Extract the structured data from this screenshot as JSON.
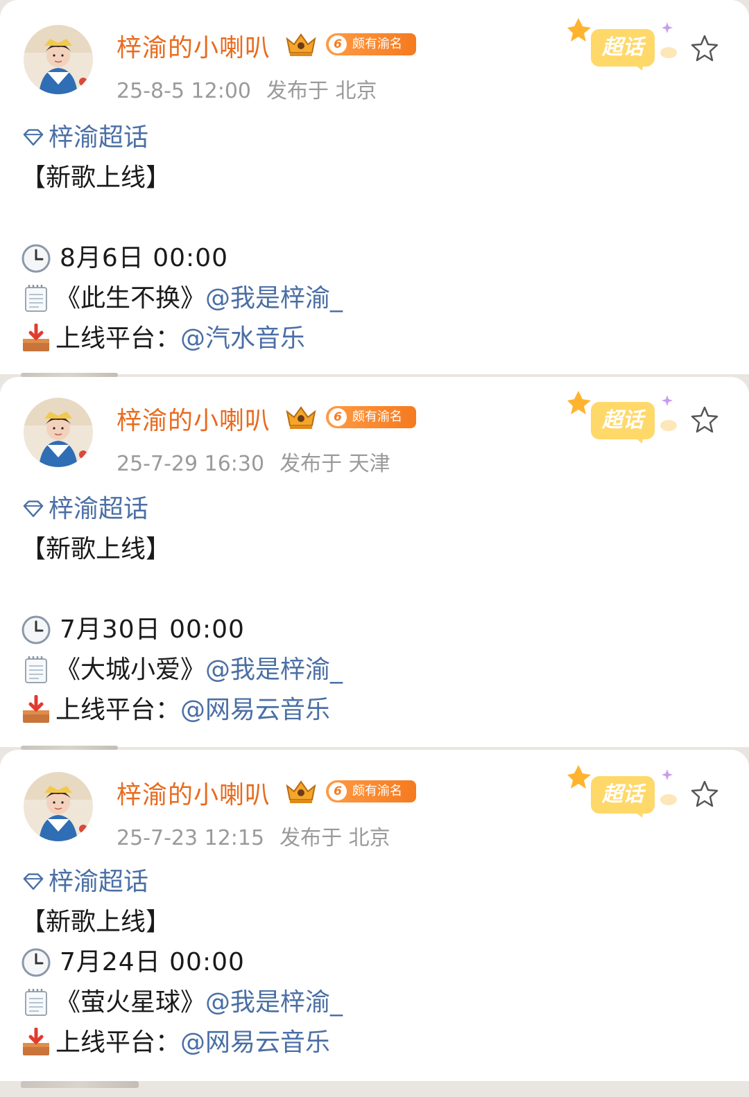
{
  "posts": [
    {
      "username": "梓渝的小喇叭",
      "fan_badge": {
        "level": "6",
        "text": "颇有渝名"
      },
      "time": "25-8-5 12:00",
      "location": "发布于 北京",
      "chaohua_label": "超话",
      "topic": "梓渝超话",
      "headline": "【新歌上线】",
      "date_line": "8月6日 00:00",
      "song_title": "《此生不换》",
      "song_mention": "@我是梓渝_",
      "platform_label": "上线平台：",
      "platform_mention": "@汽水音乐"
    },
    {
      "username": "梓渝的小喇叭",
      "fan_badge": {
        "level": "6",
        "text": "颇有渝名"
      },
      "time": "25-7-29 16:30",
      "location": "发布于 天津",
      "chaohua_label": "超话",
      "topic": "梓渝超话",
      "headline": "【新歌上线】",
      "date_line": "7月30日 00:00",
      "song_title": "《大城小爱》",
      "song_mention": "@我是梓渝_",
      "platform_label": "上线平台：",
      "platform_mention": "@网易云音乐"
    },
    {
      "username": "梓渝的小喇叭",
      "fan_badge": {
        "level": "6",
        "text": "颇有渝名"
      },
      "time": "25-7-23 12:15",
      "location": "发布于 北京",
      "chaohua_label": "超话",
      "topic": "梓渝超话",
      "headline": "【新歌上线】",
      "date_line": "7月24日 00:00",
      "song_title": "《萤火星球》",
      "song_mention": "@我是梓渝_",
      "platform_label": "上线平台：",
      "platform_mention": "@网易云音乐"
    }
  ],
  "icons": {
    "topic": "diamond-icon",
    "date": "clock-icon",
    "song": "notepad-icon",
    "platform": "inbox-tray-icon",
    "favorite": "star-outline-icon",
    "super_topic": "chaohua-badge-icon",
    "rank": "crown-icon"
  },
  "colors": {
    "username": "#e86b1f",
    "link": "#4a6fa5",
    "meta": "#9a9a9a",
    "badge": "#f57a1f",
    "chaohua": "#ffc84a"
  }
}
